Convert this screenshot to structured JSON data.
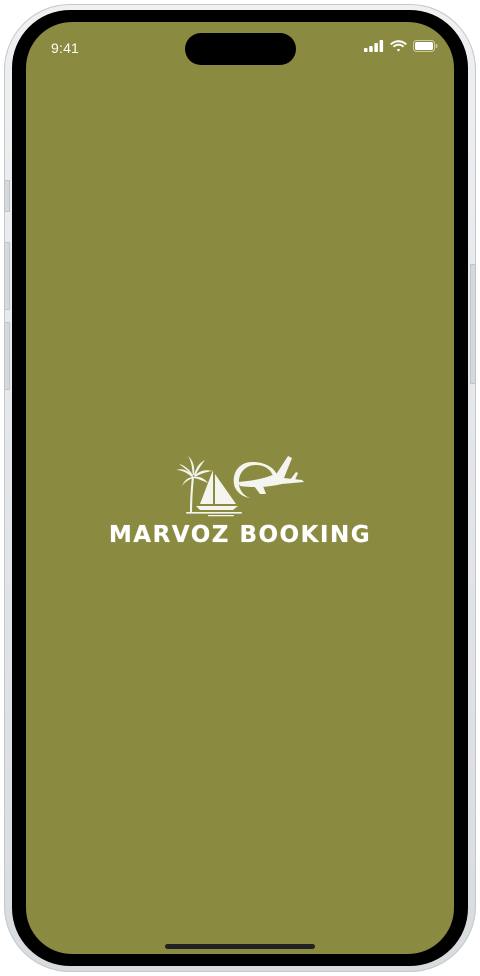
{
  "status_bar": {
    "time": "9:41",
    "icons": [
      "cellular-signal-icon",
      "wifi-icon",
      "battery-icon"
    ]
  },
  "splash": {
    "brand_name": "MARVOZ BOOKING",
    "logo_icons": [
      "palm-tree-icon",
      "sailboat-icon",
      "airplane-icon"
    ]
  },
  "colors": {
    "background": "#8a8a40",
    "logo": "#ffffff",
    "bezel": "#000000",
    "frame": "#e6e8ea"
  }
}
